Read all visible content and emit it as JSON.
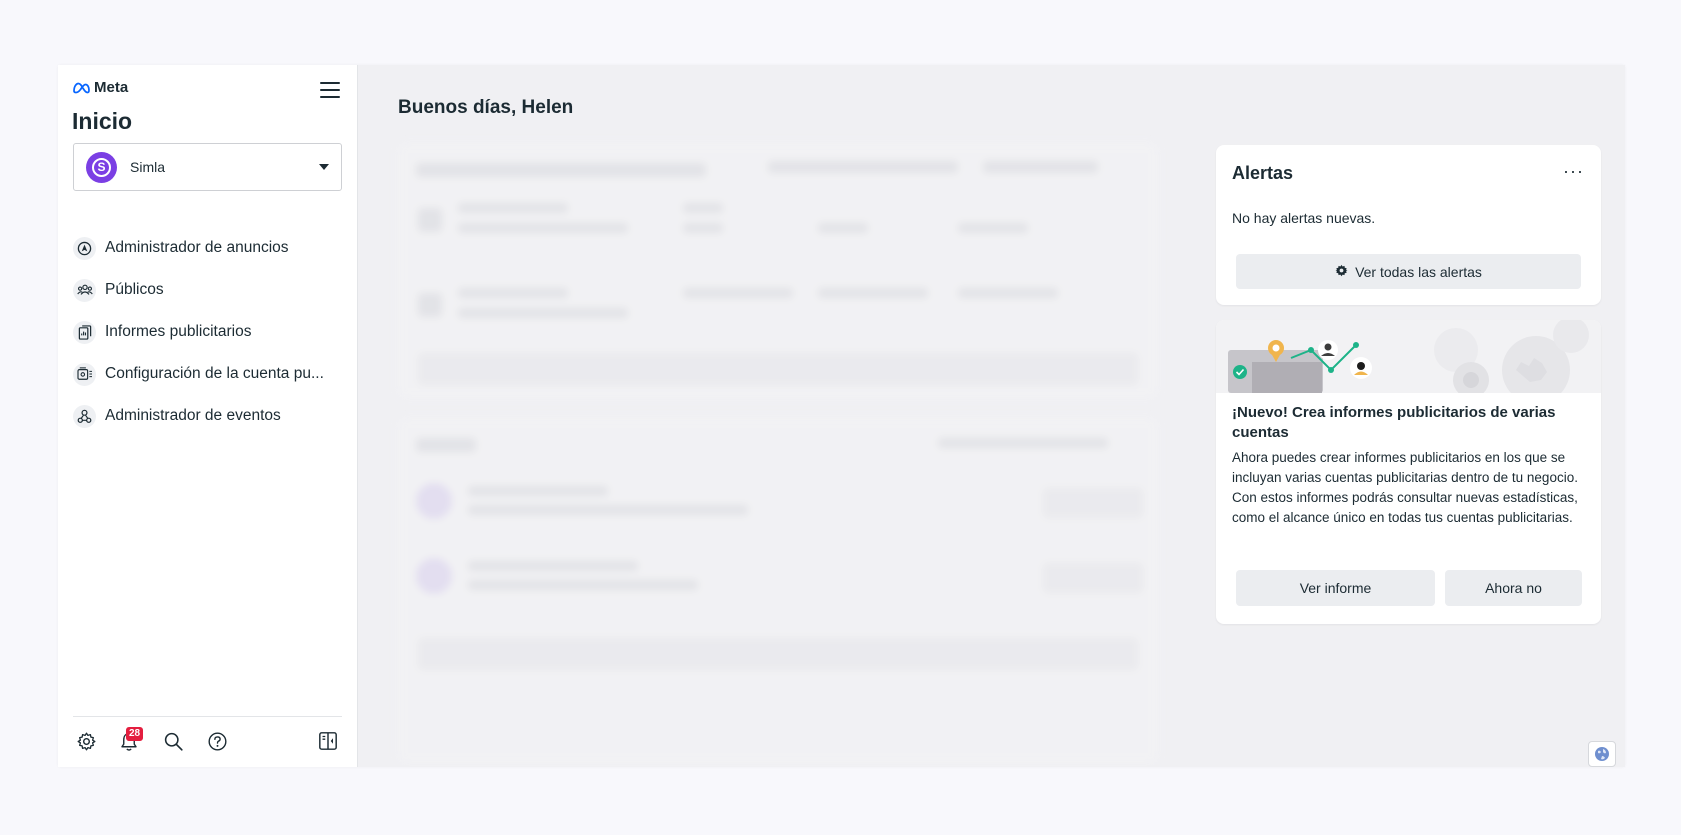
{
  "brand": {
    "name": "Meta",
    "icon": "meta-logo-icon"
  },
  "sidebar": {
    "title": "Inicio",
    "account": {
      "name": "Simla",
      "avatar_letter": "S",
      "avatar_color": "#7b3fe4"
    },
    "items": [
      {
        "label": "Administrador de anuncios",
        "icon": "ads-manager-icon"
      },
      {
        "label": "Públicos",
        "icon": "audiences-icon"
      },
      {
        "label": "Informes publicitarios",
        "icon": "ads-reporting-icon"
      },
      {
        "label": "Configuración de la cuenta pu...",
        "icon": "account-settings-icon"
      },
      {
        "label": "Administrador de eventos",
        "icon": "events-manager-icon"
      }
    ],
    "footer": {
      "notifications_count": "28",
      "icons": [
        "settings-icon",
        "notifications-icon",
        "search-icon",
        "help-icon",
        "collapse-panel-icon"
      ]
    }
  },
  "main": {
    "greeting": "Buenos días, Helen"
  },
  "alerts": {
    "title": "Alertas",
    "more_label": "···",
    "empty_text": "No hay alertas nuevas.",
    "view_all_label": "Ver todas las alertas"
  },
  "promo": {
    "heading": "¡Nuevo! Crea informes publicitarios de varias cuentas",
    "body": "Ahora puedes crear informes publicitarios en los que se incluyan varias cuentas publicitarias dentro de tu negocio. Con estos informes podrás consultar nuevas estadísticas, como el alcance único en todas tus cuentas publicitarias.",
    "primary_label": "Ver informe",
    "secondary_label": "Ahora no"
  },
  "colors": {
    "accent_purple": "#7b3fe4",
    "badge_red": "#e41e3f",
    "meta_blue": "#0866ff",
    "text": "#1c2b33"
  }
}
